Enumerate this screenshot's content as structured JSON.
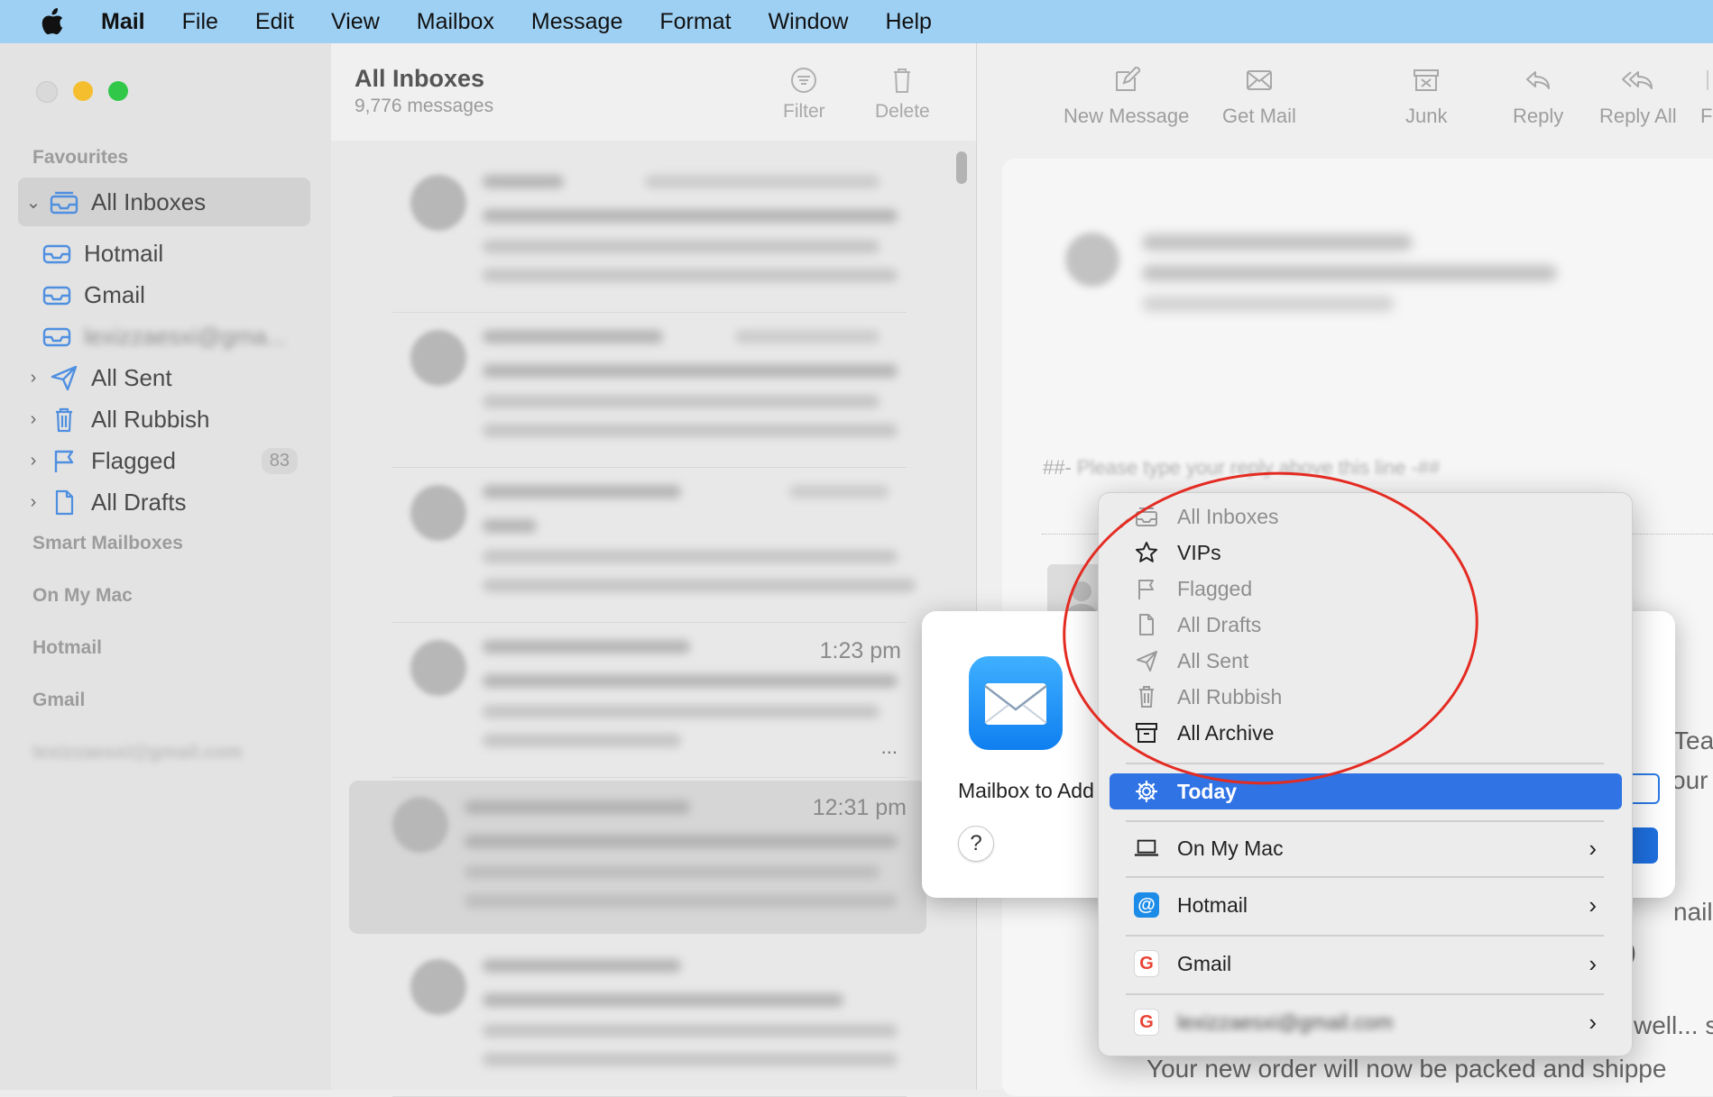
{
  "menubar": {
    "app": "Mail",
    "items": [
      "File",
      "Edit",
      "View",
      "Mailbox",
      "Message",
      "Format",
      "Window",
      "Help"
    ]
  },
  "sidebar": {
    "favourites_header": "Favourites",
    "all_inboxes": "All Inboxes",
    "hotmail": "Hotmail",
    "gmail": "Gmail",
    "blurred_account": "lexizzaesxi@gma...",
    "all_sent": "All Sent",
    "all_rubbish": "All Rubbish",
    "flagged": "Flagged",
    "flagged_count": "83",
    "all_drafts": "All Drafts",
    "smart_mailboxes": "Smart Mailboxes",
    "on_my_mac": "On My Mac",
    "hotmail_header": "Hotmail",
    "gmail_header": "Gmail",
    "blurred_header": "lexizzaesxi@gmail.com"
  },
  "message_list": {
    "title": "All Inboxes",
    "count": "9,776 messages",
    "filter_label": "Filter",
    "delete_label": "Delete",
    "times": [
      "",
      "",
      "",
      "1:23 pm",
      "12:31 pm",
      ""
    ],
    "more": "..."
  },
  "toolbar": {
    "new_message": "New Message",
    "get_mail": "Get Mail",
    "junk": "Junk",
    "reply": "Reply",
    "reply_all": "Reply All",
    "forward": "F"
  },
  "reader": {
    "reply_marker_prefix": "##-",
    "reply_marker_rest": " Please type your reply above this line -##",
    "frag_1": "Tea",
    "frag_2": "our",
    "frag_3": "nail",
    "frag_4": ";)",
    "frag_5": "well... s",
    "frag_6": "Your new order will now be packed and shippe"
  },
  "dialog": {
    "label": "Mailbox to Add",
    "help": "?"
  },
  "menu": {
    "all_inboxes": "All Inboxes",
    "vips": "VIPs",
    "flagged": "Flagged",
    "all_drafts": "All Drafts",
    "all_sent": "All Sent",
    "all_rubbish": "All Rubbish",
    "all_archive": "All Archive",
    "today": "Today",
    "on_my_mac": "On My Mac",
    "hotmail": "Hotmail",
    "gmail": "Gmail",
    "blurred_account": "lexizzaesxi@gmail.com",
    "arrow": "›"
  },
  "colors": {
    "menubar": "#9ed0f3",
    "highlight": "#2f73e4",
    "annotation": "#e42b22",
    "traffic_red": "#d9d9d9",
    "traffic_yellow": "#f5be2e",
    "traffic_green": "#31c84a"
  }
}
